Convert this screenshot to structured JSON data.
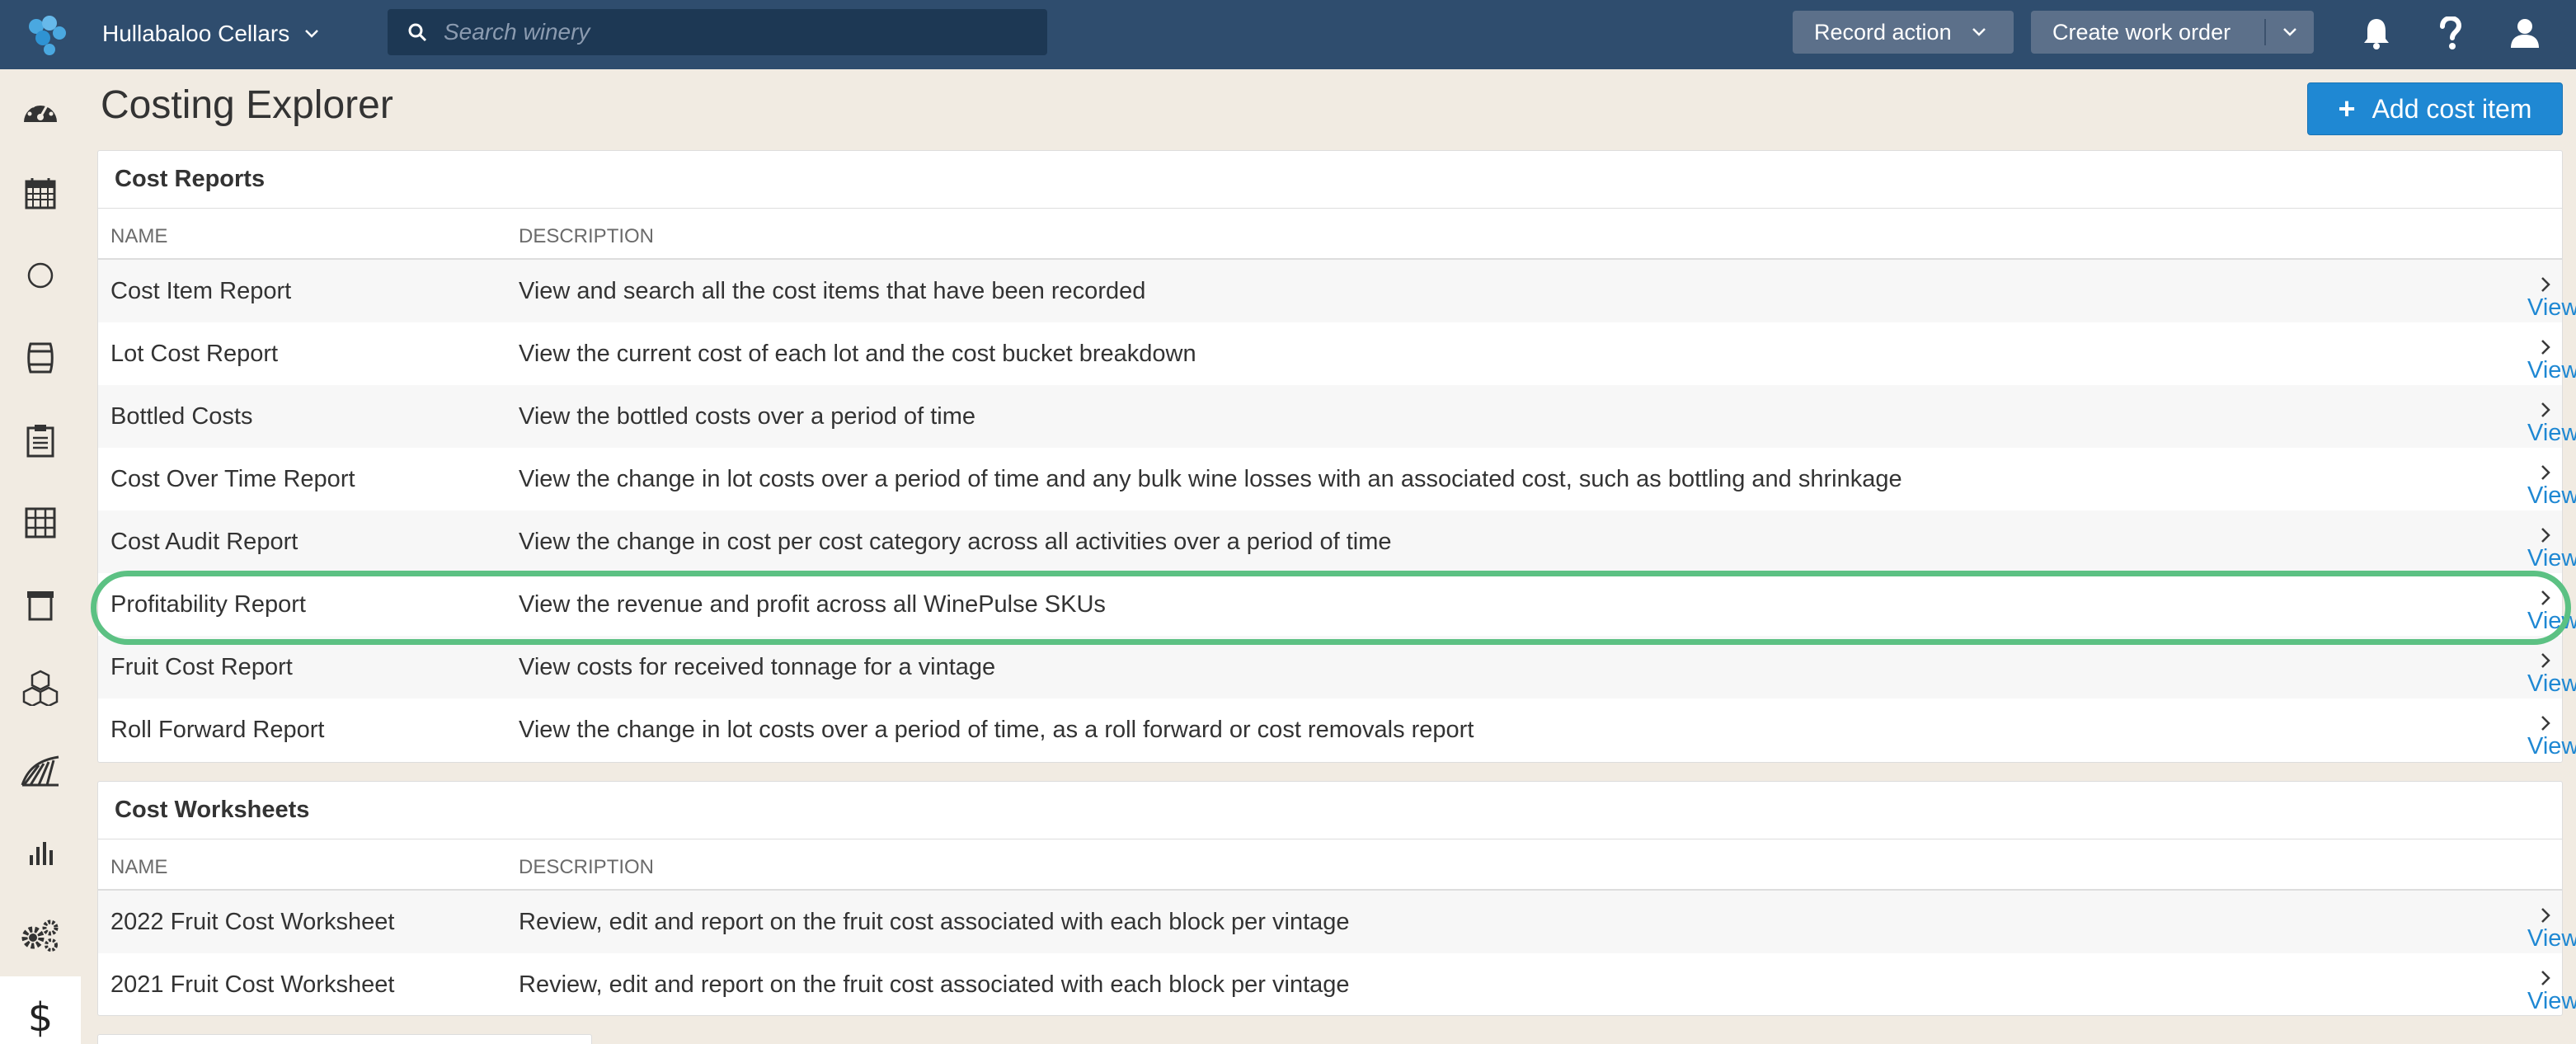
{
  "topbar": {
    "winery": "Hullabaloo Cellars",
    "search_placeholder": "Search winery",
    "record_action": "Record action",
    "create_work_order": "Create work order",
    "icons": [
      "bell-icon",
      "help-icon",
      "user-icon"
    ]
  },
  "sidebar": {
    "items": [
      "dashboard-icon",
      "calendar-icon",
      "circle-icon",
      "barrel-icon",
      "clipboard-icon",
      "grid-icon",
      "archive-icon",
      "cubes-icon",
      "vineyard-icon",
      "bar-chart-icon",
      "gears-icon",
      "dollar-icon"
    ],
    "active": "dollar-icon"
  },
  "page": {
    "title": "Costing Explorer",
    "add_button": "Add cost item"
  },
  "cost_reports": {
    "title": "Cost Reports",
    "col_name": "NAME",
    "col_description": "DESCRIPTION",
    "rows": [
      {
        "name": "Cost Item Report",
        "description": "View and search all the cost items that have been recorded",
        "link": "View Report"
      },
      {
        "name": "Lot Cost Report",
        "description": "View the current cost of each lot and the cost bucket breakdown",
        "link": "View Report"
      },
      {
        "name": "Bottled Costs",
        "description": "View the bottled costs over a period of time",
        "link": "View Report"
      },
      {
        "name": "Cost Over Time Report",
        "description": "View the change in lot costs over a period of time and any bulk wine losses with an associated cost, such as bottling and shrinkage",
        "link": "View Report"
      },
      {
        "name": "Cost Audit Report",
        "description": "View the change in cost per cost category across all activities over a period of time",
        "link": "View Report"
      },
      {
        "name": "Profitability Report",
        "description": "View the revenue and profit across all WinePulse SKUs",
        "link": "View Report"
      },
      {
        "name": "Fruit Cost Report",
        "description": "View costs for received tonnage for a vintage",
        "link": "View Report"
      },
      {
        "name": "Roll Forward Report",
        "description": "View the change in lot costs over a period of time, as a roll forward or cost removals report",
        "link": "View Report"
      }
    ]
  },
  "cost_worksheets": {
    "title": "Cost Worksheets",
    "col_name": "NAME",
    "col_description": "DESCRIPTION",
    "rows": [
      {
        "name": "2022 Fruit Cost Worksheet",
        "description": "Review, edit and report on the fruit cost associated with each block per vintage",
        "link": "View Report"
      },
      {
        "name": "2021 Fruit Cost Worksheet",
        "description": "Review, edit and report on the fruit cost associated with each block per vintage",
        "link": "View Report"
      }
    ]
  },
  "colors": {
    "topbar": "#2f4d6e",
    "accent": "#1f88d3",
    "highlight": "#5cc183",
    "background": "#f1ebe2"
  }
}
